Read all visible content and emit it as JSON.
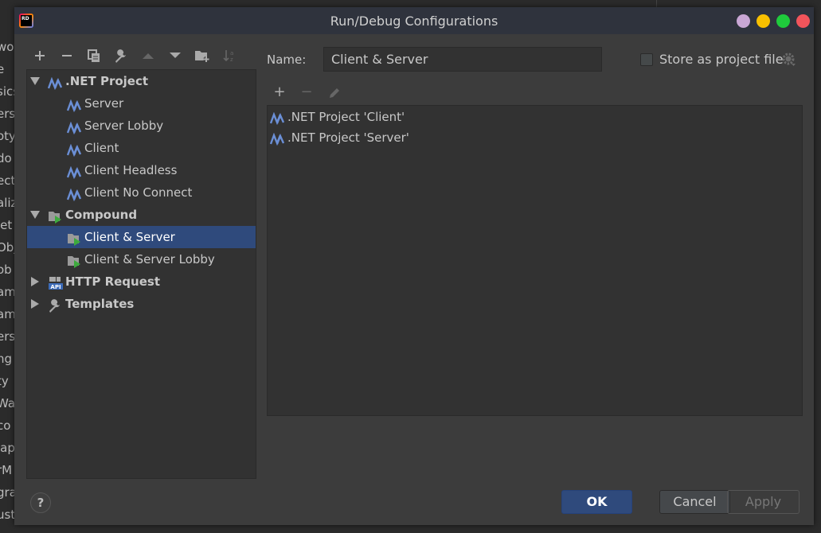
{
  "background_fragments": [
    "wo",
    "e",
    "sics",
    "ers",
    "oty",
    "do",
    "ect",
    "aliz",
    "let",
    "Obj",
    "ob",
    "am",
    "am",
    "ers",
    "ng",
    "ty",
    "Wa",
    "co",
    "lap",
    "rM",
    "gra",
    "ust"
  ],
  "window": {
    "title": "Run/Debug Configurations",
    "logo_text": "RD",
    "dot_colors": [
      "#c9a7d5",
      "#f9c000",
      "#1fcb3c",
      "#f2545b"
    ]
  },
  "toolbar": {
    "icons": [
      "add-icon",
      "remove-icon",
      "copy-icon",
      "wrench-icon",
      "move-up-icon",
      "move-down-icon",
      "new-folder-icon",
      "sort-az-icon"
    ]
  },
  "tree": {
    "items": [
      {
        "label": ".NET Project",
        "group": true,
        "expanded": true,
        "icon": "dotnet-icon"
      },
      {
        "label": "Server",
        "icon": "dotnet-icon"
      },
      {
        "label": "Server Lobby",
        "icon": "dotnet-icon"
      },
      {
        "label": "Client",
        "icon": "dotnet-icon"
      },
      {
        "label": "Client Headless",
        "icon": "dotnet-icon"
      },
      {
        "label": "Client No Connect",
        "icon": "dotnet-icon"
      },
      {
        "label": "Compound",
        "group": true,
        "expanded": true,
        "icon": "compound-icon"
      },
      {
        "label": "Client & Server",
        "icon": "compound-icon",
        "selected": true
      },
      {
        "label": "Client & Server Lobby",
        "icon": "compound-icon"
      },
      {
        "label": "HTTP Request",
        "group": true,
        "expanded": false,
        "icon": "api-icon"
      },
      {
        "label": "Templates",
        "group": true,
        "expanded": false,
        "icon": "wrench-icon"
      }
    ]
  },
  "form": {
    "name_label": "Name:",
    "name_value": "Client & Server",
    "store_label": "Store as project file",
    "store_checked": false
  },
  "configs": [
    "‪.NET Project 'Client'",
    ".NET Project 'Server'"
  ],
  "buttons": {
    "help": "?",
    "ok": "OK",
    "cancel": "Cancel",
    "apply": "Apply"
  },
  "colors": {
    "selection": "#2f4a7c",
    "ok_button": "#2f4a7c",
    "dotnet_icon": "#6b8fd6"
  }
}
